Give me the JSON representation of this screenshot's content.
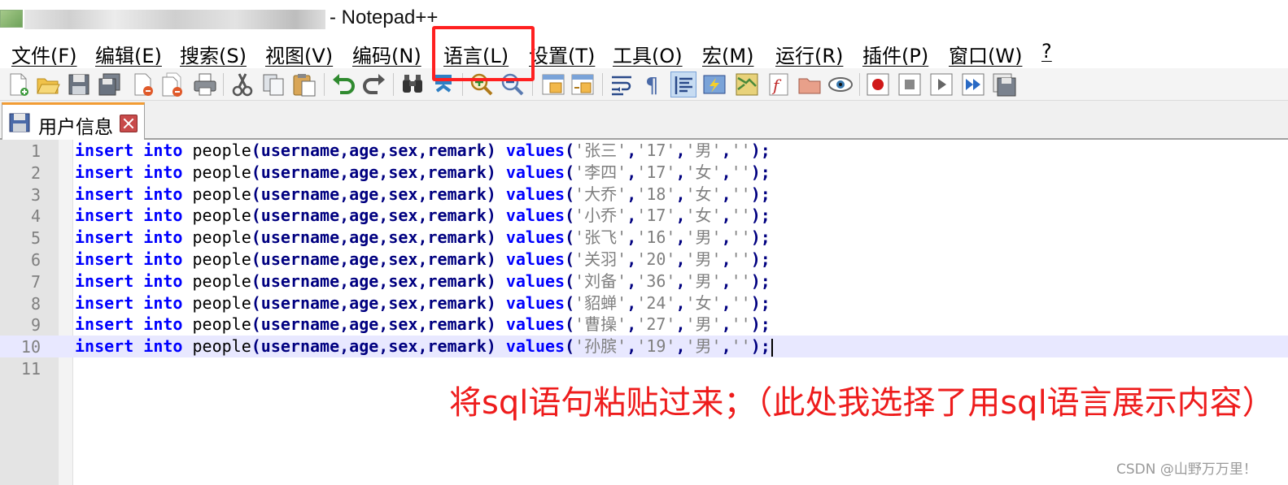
{
  "window": {
    "title": "- Notepad++"
  },
  "menu": [
    "文件(F)",
    "编辑(E)",
    "搜索(S)",
    "视图(V)",
    "编码(N)",
    "语言(L)",
    "设置(T)",
    "工具(O)",
    "宏(M)",
    "运行(R)",
    "插件(P)",
    "窗口(W)",
    "?"
  ],
  "toolbar": {
    "icons": [
      "new-file-icon",
      "open-file-icon",
      "save-icon",
      "save-all-icon",
      "close-icon",
      "close-all-icon",
      "print-icon",
      "cut-icon",
      "copy-icon",
      "paste-icon",
      "undo-icon",
      "redo-icon",
      "find-icon",
      "replace-icon",
      "zoom-in-icon",
      "zoom-out-icon",
      "sync-vertical-icon",
      "sync-horizontal-icon",
      "word-wrap-icon",
      "show-all-chars-icon",
      "indent-guide-icon",
      "language-define-icon",
      "doc-map-icon",
      "function-list-icon",
      "folder-workspace-icon",
      "monitoring-icon",
      "record-macro-icon",
      "stop-record-icon",
      "play-macro-icon",
      "run-macro-multiple-icon",
      "save-macro-icon"
    ]
  },
  "tabs": [
    {
      "label": "用户信息"
    }
  ],
  "editor": {
    "lines": [
      {
        "num": "1",
        "kw1": "insert",
        "kw2": "into",
        "pre": "people",
        "fields": "(username,age,sex,remark)",
        "kw3": "values",
        "open": "(",
        "name": "'张三'",
        "age": "'17'",
        "sex": "'男'",
        "remark": "''",
        "close": ");"
      },
      {
        "num": "2",
        "kw1": "insert",
        "kw2": "into",
        "pre": "people",
        "fields": "(username,age,sex,remark)",
        "kw3": "values",
        "open": "(",
        "name": "'李四'",
        "age": "'17'",
        "sex": "'女'",
        "remark": "''",
        "close": ");"
      },
      {
        "num": "3",
        "kw1": "insert",
        "kw2": "into",
        "pre": "people",
        "fields": "(username,age,sex,remark)",
        "kw3": "values",
        "open": "(",
        "name": "'大乔'",
        "age": "'18'",
        "sex": "'女'",
        "remark": "''",
        "close": ");"
      },
      {
        "num": "4",
        "kw1": "insert",
        "kw2": "into",
        "pre": "people",
        "fields": "(username,age,sex,remark)",
        "kw3": "values",
        "open": "(",
        "name": "'小乔'",
        "age": "'17'",
        "sex": "'女'",
        "remark": "''",
        "close": ");"
      },
      {
        "num": "5",
        "kw1": "insert",
        "kw2": "into",
        "pre": "people",
        "fields": "(username,age,sex,remark)",
        "kw3": "values",
        "open": "(",
        "name": "'张飞'",
        "age": "'16'",
        "sex": "'男'",
        "remark": "''",
        "close": ");"
      },
      {
        "num": "6",
        "kw1": "insert",
        "kw2": "into",
        "pre": "people",
        "fields": "(username,age,sex,remark)",
        "kw3": "values",
        "open": "(",
        "name": "'关羽'",
        "age": "'20'",
        "sex": "'男'",
        "remark": "''",
        "close": ");"
      },
      {
        "num": "7",
        "kw1": "insert",
        "kw2": "into",
        "pre": "people",
        "fields": "(username,age,sex,remark)",
        "kw3": "values",
        "open": "(",
        "name": "'刘备'",
        "age": "'36'",
        "sex": "'男'",
        "remark": "''",
        "close": ");"
      },
      {
        "num": "8",
        "kw1": "insert",
        "kw2": "into",
        "pre": "people",
        "fields": "(username,age,sex,remark)",
        "kw3": "values",
        "open": "(",
        "name": "'貂蝉'",
        "age": "'24'",
        "sex": "'女'",
        "remark": "''",
        "close": ");"
      },
      {
        "num": "9",
        "kw1": "insert",
        "kw2": "into",
        "pre": "people",
        "fields": "(username,age,sex,remark)",
        "kw3": "values",
        "open": "(",
        "name": "'曹操'",
        "age": "'27'",
        "sex": "'男'",
        "remark": "''",
        "close": ");"
      },
      {
        "num": "10",
        "kw1": "insert",
        "kw2": "into",
        "pre": "people",
        "fields": "(username,age,sex,remark)",
        "kw3": "values",
        "open": "(",
        "name": "'孙膑'",
        "age": "'19'",
        "sex": "'男'",
        "remark": "''",
        "close": ");"
      },
      {
        "num": "11"
      }
    ],
    "current_line": 10
  },
  "annotation": {
    "text": "将sql语句粘贴过来；（此处我选择了用sql语言展示内容）",
    "highlighted_menu": "语言(L)",
    "color": "#ee1c1c"
  },
  "watermark": "CSDN @山野万万里！",
  "colors": {
    "keyword": "#0000ff",
    "string": "#808080",
    "operator": "#000080",
    "tab_accent": "#f29c34",
    "current_line_bg": "#e8e8ff"
  }
}
